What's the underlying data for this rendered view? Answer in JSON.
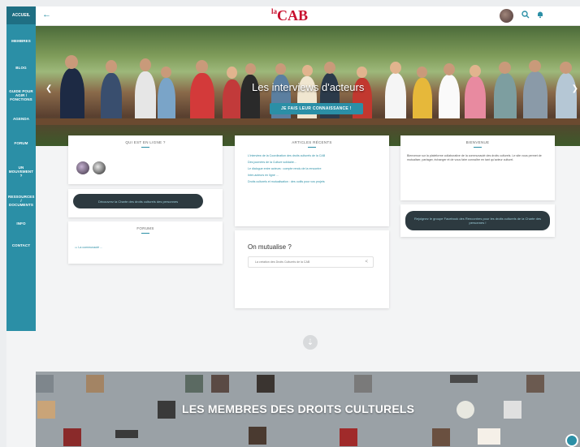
{
  "sidebar": {
    "logo": "ACCUEIL",
    "items": [
      {
        "label": "MEMBRES"
      },
      {
        "label": "BLOG"
      },
      {
        "label": "GUIDE POUR AGIR / FONCTIONS"
      },
      {
        "label": "AGENDA"
      },
      {
        "label": "FORUM"
      },
      {
        "label": "UN MOUVEMENT ?"
      },
      {
        "label": "RESSOURCES / DOCUMENTS"
      },
      {
        "label": "INFO"
      },
      {
        "label": "CONTACT"
      }
    ]
  },
  "topbar": {
    "logo_prefix": "la",
    "logo_main": "CAB"
  },
  "hero": {
    "title": "Les interviews d'acteurs",
    "button": "JE FAIS LEUR CONNAISSANCE !"
  },
  "cards": {
    "who_online": {
      "title": "QUI EST EN LIGNE ?"
    },
    "charter_pill": "Découvrez la Charte des droits culturels des personnes",
    "forum": {
      "title": "FORUMS",
      "link": "La communauté ..."
    },
    "recent_articles": {
      "title": "ARTICLES RÉCENTS",
      "links": [
        "L'interview de la Coordination des droits culturels de la CAB",
        "Des journées de la Culture solidaire...",
        "Le dialogue entre acteurs : compte rendu de la rencontre",
        "Inter-acteurs en ligne ...",
        "Droits culturels et mutualisation : des outils pour vos projets"
      ]
    },
    "mutual": {
      "title": "On mutualise ?",
      "field": "La création des Droits Culturels de la CAB"
    },
    "welcome": {
      "title": "BIENVENUE",
      "text": "Bienvenue sur la plateforme collaborative de la communauté des droits culturels. Le site vous permet de mutualiser, partager, échanger et de vous faire connaître en tant qu'acteur culturel."
    },
    "facebook_pill": "Rejoignez le groupe Facebook des Rencontres pour les droits culturels de la Charte des personnes !"
  },
  "members": {
    "title": "LES MEMBRES DES DROITS CULTURELS"
  },
  "colors": {
    "accent": "#2b8fa6",
    "logo_red": "#c8102e",
    "dark_pill": "#2d3a40"
  }
}
